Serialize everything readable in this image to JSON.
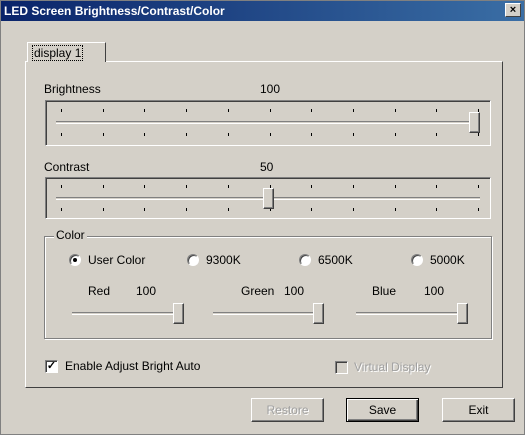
{
  "window": {
    "title": "LED Screen Brightness/Contrast/Color",
    "close_glyph": "×"
  },
  "tabs": [
    {
      "label": "display 1",
      "selected": true
    }
  ],
  "brightness": {
    "label": "Brightness",
    "value": "100",
    "level": 100
  },
  "contrast": {
    "label": "Contrast",
    "value": "50",
    "level": 50
  },
  "color_group": {
    "label": "Color",
    "selected": "User Color",
    "options": [
      "User Color",
      "9300K",
      "6500K",
      "5000K"
    ],
    "channels": [
      {
        "label": "Red",
        "value": "100",
        "level": 100
      },
      {
        "label": "Green",
        "value": "100",
        "level": 100
      },
      {
        "label": "Blue",
        "value": "100",
        "level": 100
      }
    ]
  },
  "checkboxes": {
    "auto_bright": {
      "label": "Enable Adjust Bright Auto",
      "checked": true,
      "enabled": true
    },
    "virtual_display": {
      "label": "Virtual Display",
      "checked": false,
      "enabled": false
    }
  },
  "buttons": {
    "restore": "Restore",
    "save": "Save",
    "exit": "Exit"
  },
  "colors": {
    "title_bar": "#0a246a",
    "face": "#d4d0c8"
  }
}
